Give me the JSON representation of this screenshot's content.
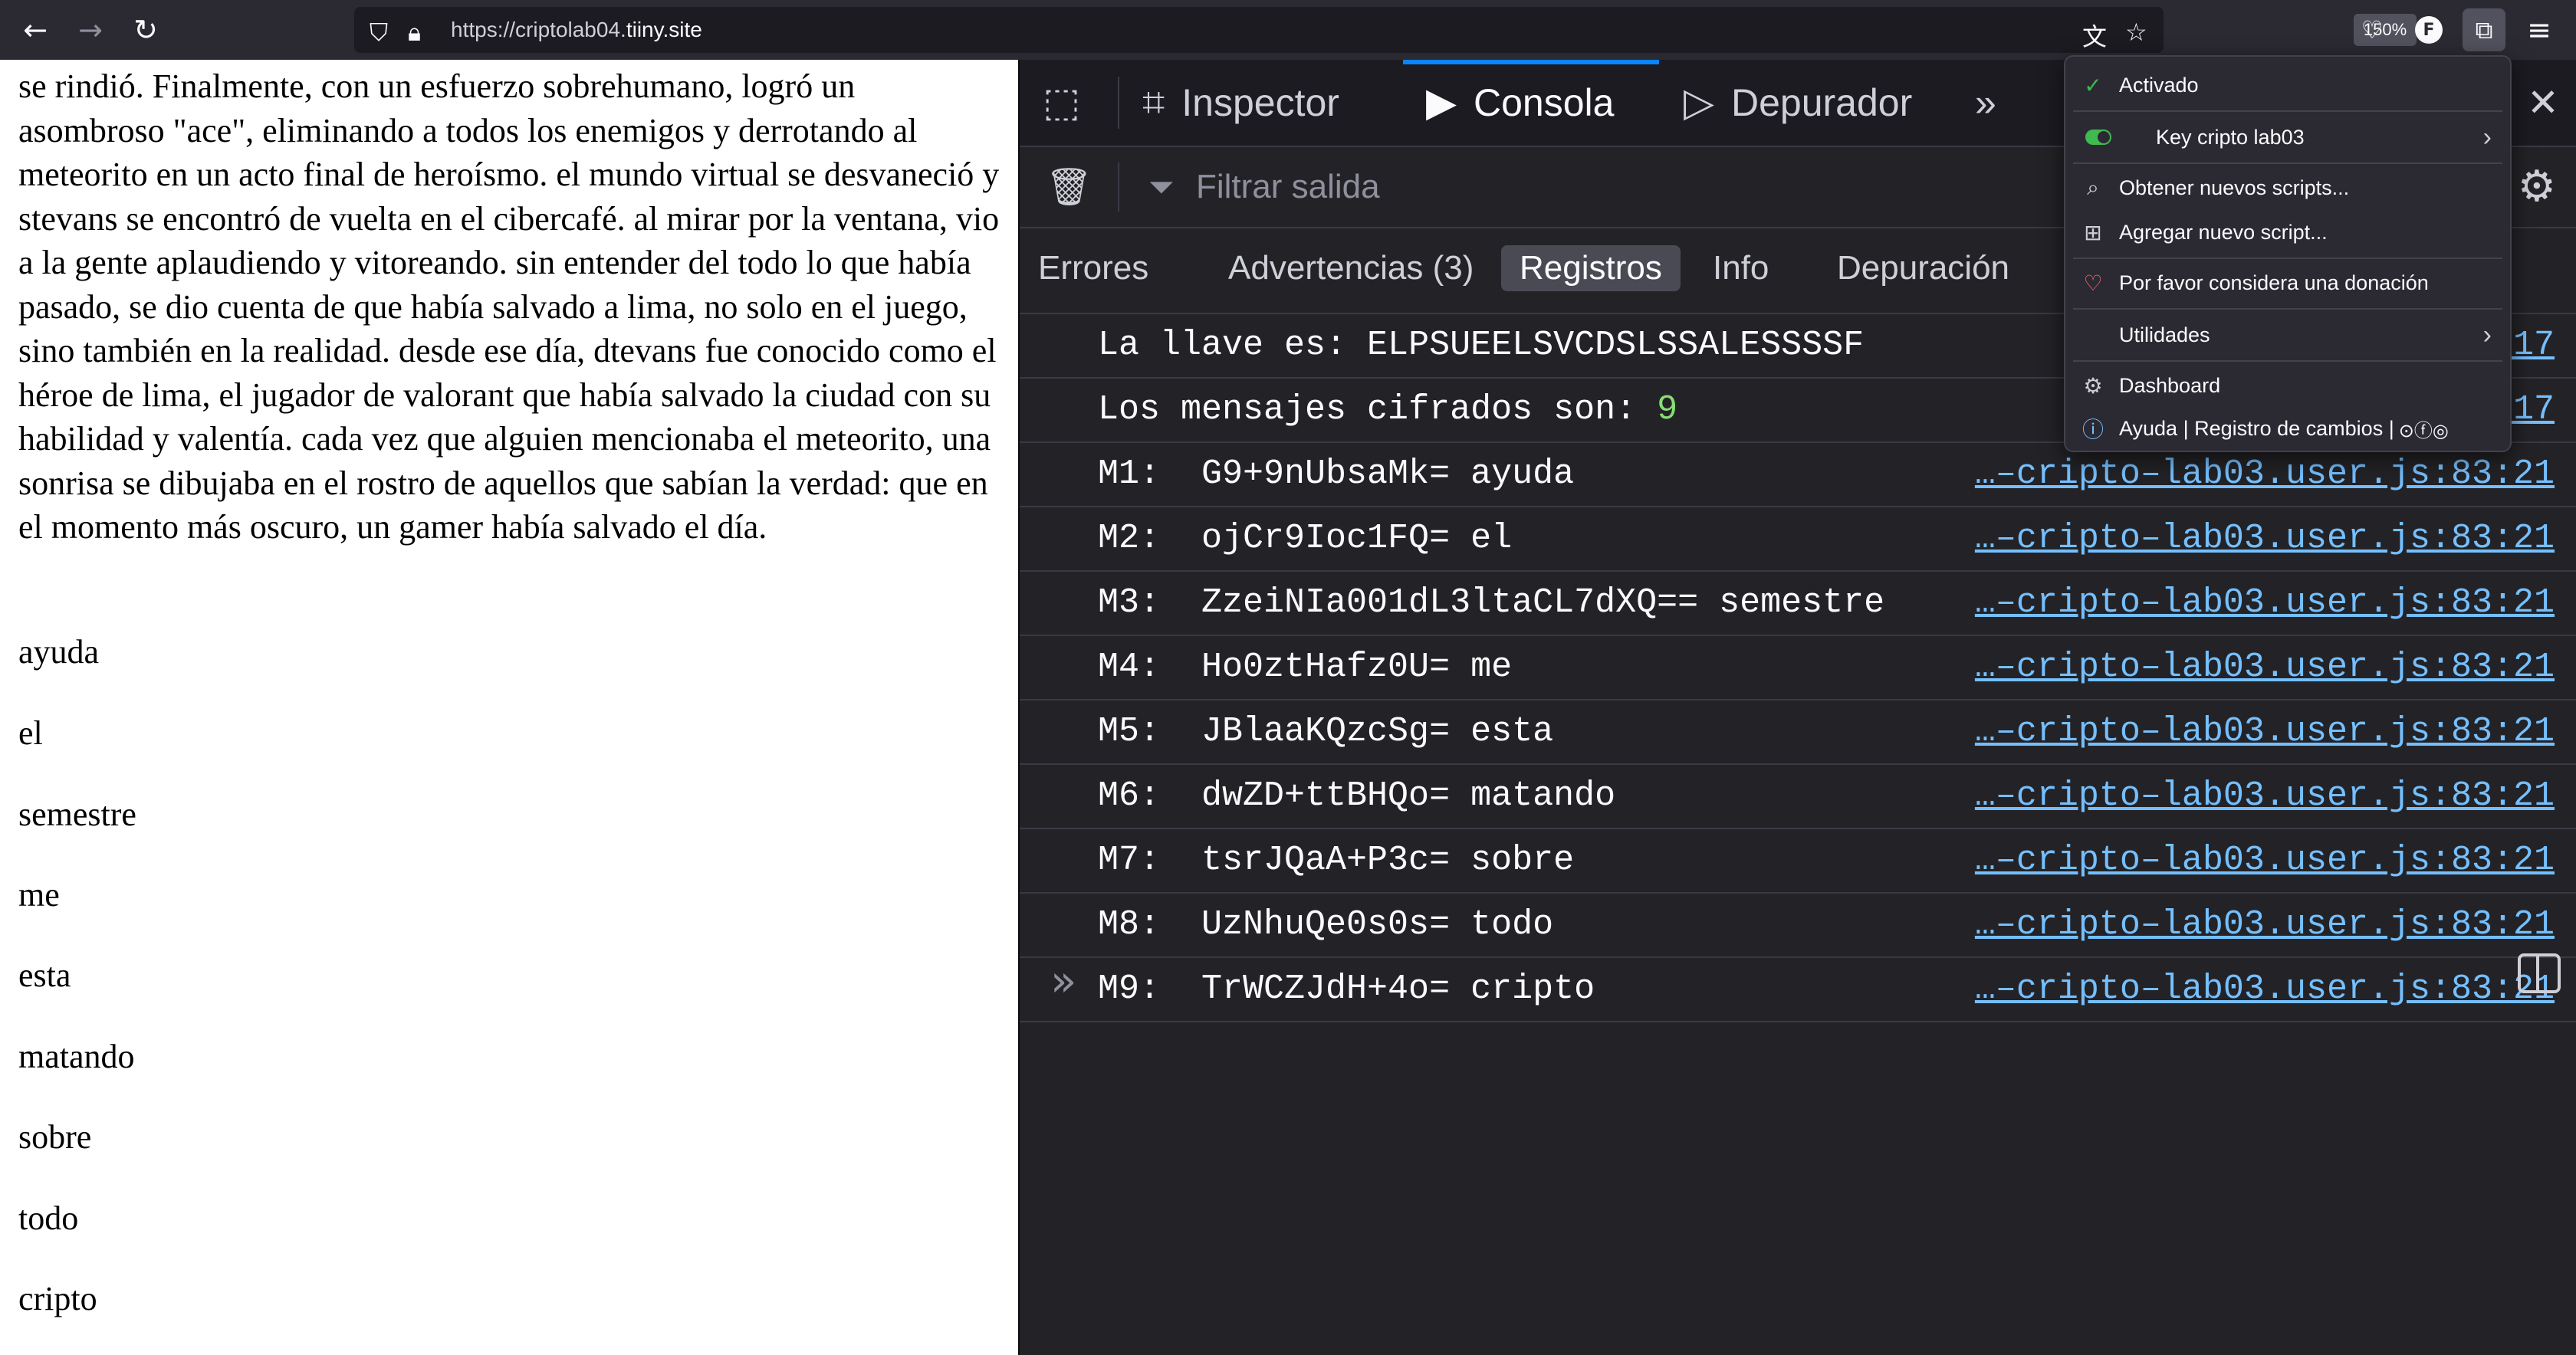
{
  "browser": {
    "url_prefix": "https://criptolab04.",
    "url_host": "tiiny.site",
    "zoom": "150%",
    "avatar_letter": "F"
  },
  "page": {
    "story": "se rindió. Finalmente, con un esfuerzo sobrehumano, logró un asombroso \"ace\", eliminando a todos los enemigos y derrotando al meteorito en un acto final de heroísmo. el mundo virtual se desvaneció y stevans se encontró de vuelta en el cibercafé. al mirar por la ventana, vio a la gente aplaudiendo y vitoreando. sin entender del todo lo que había pasado, se dio cuenta de que había salvado a lima, no solo en el juego, sino también en la realidad. desde ese día, dtevans fue conocido como el héroe de lima, el jugador de valorant que había salvado la ciudad con su habilidad y valentía. cada vez que alguien mencionaba el meteorito, una sonrisa se dibujaba en el rostro de aquellos que sabían la verdad: que en el momento más oscuro, un gamer había salvado el día.",
    "words": [
      "ayuda",
      "el",
      "semestre",
      "me",
      "esta",
      "matando",
      "sobre",
      "todo",
      "cripto"
    ]
  },
  "devtools": {
    "tabs": {
      "inspector": "Inspector",
      "console": "Consola",
      "debugger": "Depurador"
    },
    "filter_placeholder": "Filtrar salida",
    "categories": {
      "errors": "Errores",
      "warnings": "Advertencias (3)",
      "logs": "Registros",
      "info": "Info",
      "debug": "Depuración"
    },
    "key_line": {
      "label": "La llave es: ELPSUEELSVCDSLSSALESSSSF",
      "src": "…–cri…17"
    },
    "count_line": {
      "label": "Los mensajes cifrados son: ",
      "value": "9",
      "src": "…–cri…17"
    },
    "messages": [
      {
        "id": "M1:",
        "cipher": "G9+9nUbsaMk=",
        "plain": "ayuda",
        "src": "…–cripto–lab03.user.js:83:21"
      },
      {
        "id": "M2:",
        "cipher": "ojCr9Ioc1FQ=",
        "plain": "el",
        "src": "…–cripto–lab03.user.js:83:21"
      },
      {
        "id": "M3:",
        "cipher": "ZzeiNIa001dL3ltaCL7dXQ==",
        "plain": "semestre",
        "src": "…–cripto–lab03.user.js:83:21"
      },
      {
        "id": "M4:",
        "cipher": "Ho0ztHafz0U=",
        "plain": "me",
        "src": "…–cripto–lab03.user.js:83:21"
      },
      {
        "id": "M5:",
        "cipher": "JBlaaKQzcSg=",
        "plain": "esta",
        "src": "…–cripto–lab03.user.js:83:21"
      },
      {
        "id": "M6:",
        "cipher": "dwZD+ttBHQo=",
        "plain": "matando",
        "src": "…–cripto–lab03.user.js:83:21"
      },
      {
        "id": "M7:",
        "cipher": "tsrJQaA+P3c=",
        "plain": "sobre",
        "src": "…–cripto–lab03.user.js:83:21"
      },
      {
        "id": "M8:",
        "cipher": "UzNhuQe0s0s=",
        "plain": "todo",
        "src": "…–cripto–lab03.user.js:83:21"
      },
      {
        "id": "M9:",
        "cipher": "TrWCZJdH+4o=",
        "plain": "cripto",
        "src": "…–cripto–lab03.user.js:83:21"
      }
    ]
  },
  "popup": {
    "enabled": "Activado",
    "script_name": "Key cripto lab03",
    "get_scripts": "Obtener nuevos scripts...",
    "add_script": "Agregar nuevo script...",
    "donate": "Por favor considera una donación",
    "utilities": "Utilidades",
    "dashboard": "Dashboard",
    "help": "Ayuda | Registro de cambios |"
  }
}
